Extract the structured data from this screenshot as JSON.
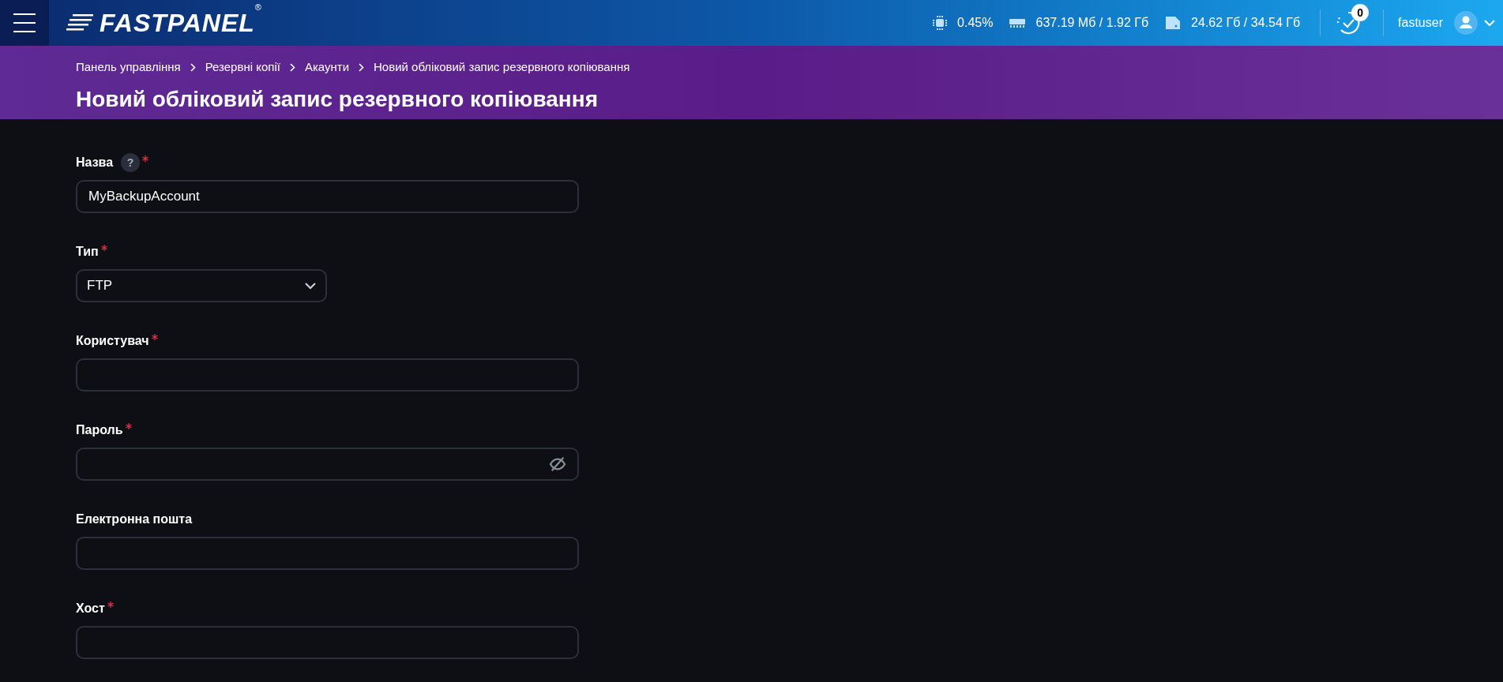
{
  "header": {
    "logo": {
      "text": "FASTPANEL",
      "mark": "®"
    },
    "stats": [
      {
        "kind": "cpu",
        "value": "0.45%"
      },
      {
        "kind": "ram",
        "value": "637.19 Мб / 1.92 Гб"
      },
      {
        "kind": "disk",
        "value": "24.62 Гб / 34.54 Гб"
      }
    ],
    "tasks_badge": "0",
    "user": "fastuser"
  },
  "breadcrumbs": [
    "Панель управління",
    "Резервні копії",
    "Акаунти",
    "Новий обліковий запис резервного копіювання"
  ],
  "page_title": "Новий обліковий запис резервного копіювання",
  "form": {
    "fields": [
      {
        "kind": "text",
        "label": "Назва",
        "help_icon": "?",
        "required": true,
        "value": "MyBackupAccount"
      },
      {
        "kind": "select",
        "label": "Тип",
        "required": true,
        "value": "FTP"
      },
      {
        "kind": "text",
        "label": "Користувач",
        "required": true
      },
      {
        "kind": "password",
        "label": "Пароль",
        "required": true
      },
      {
        "kind": "text",
        "label": "Електронна пошта",
        "required": false
      },
      {
        "kind": "text",
        "label": "Хост",
        "required": true
      }
    ]
  }
}
